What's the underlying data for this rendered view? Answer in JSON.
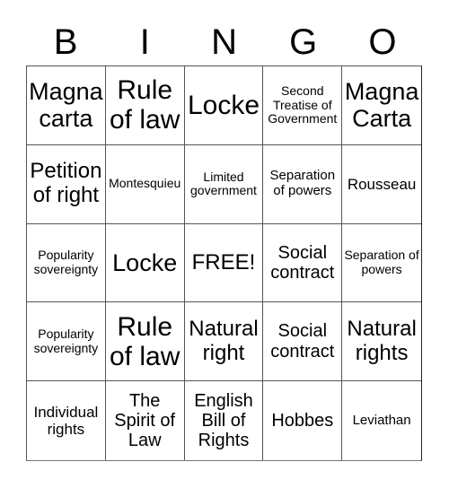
{
  "header": {
    "letters": [
      "B",
      "I",
      "N",
      "G",
      "O"
    ]
  },
  "cells": [
    [
      "Magna carta",
      "Rule of law",
      "Locke",
      "Second Treatise of Government",
      "Magna Carta"
    ],
    [
      "Petition of right",
      "Montesquieu",
      "Limited government",
      "Separation of powers",
      "Rousseau"
    ],
    [
      "Popularity sovereignty",
      "Locke",
      "FREE!",
      "Social contract",
      "Separation of powers"
    ],
    [
      "Popularity sovereignty",
      "Rule of law",
      "Natural right",
      "Social contract",
      "Natural rights"
    ],
    [
      "Individual rights",
      "The Spirit of Law",
      "English Bill of Rights",
      "Hobbes",
      "Leviathan"
    ]
  ]
}
